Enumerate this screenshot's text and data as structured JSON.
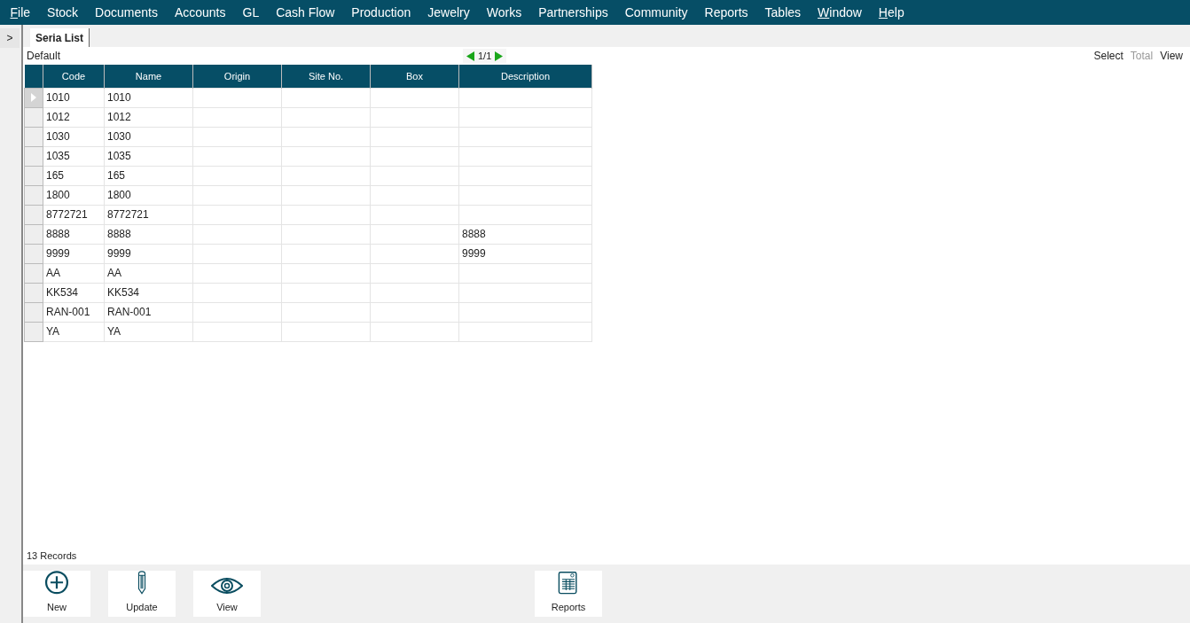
{
  "menu": [
    {
      "label": "File",
      "mnemonic": true
    },
    {
      "label": "Stock",
      "mnemonic": false
    },
    {
      "label": "Documents",
      "mnemonic": false
    },
    {
      "label": "Accounts",
      "mnemonic": false
    },
    {
      "label": "GL",
      "mnemonic": false
    },
    {
      "label": "Cash Flow",
      "mnemonic": false
    },
    {
      "label": "Production",
      "mnemonic": false
    },
    {
      "label": "Jewelry",
      "mnemonic": false
    },
    {
      "label": "Works",
      "mnemonic": false
    },
    {
      "label": "Partnerships",
      "mnemonic": false
    },
    {
      "label": "Community",
      "mnemonic": false
    },
    {
      "label": "Reports",
      "mnemonic": false
    },
    {
      "label": "Tables",
      "mnemonic": false
    },
    {
      "label": "Window",
      "mnemonic": true
    },
    {
      "label": "Help",
      "mnemonic": true
    }
  ],
  "side_toggle": ">",
  "tabs": [
    {
      "label": "Seria List",
      "selected": true
    }
  ],
  "view_name": "Default",
  "pager": {
    "text": "1/1"
  },
  "view_actions": [
    {
      "label": "Select",
      "disabled": false
    },
    {
      "label": "Total",
      "disabled": true
    },
    {
      "label": "View",
      "disabled": false
    }
  ],
  "table": {
    "columns": [
      "Code",
      "Name",
      "Origin",
      "Site No.",
      "Box",
      "Description"
    ],
    "rows": [
      {
        "selected": true,
        "cells": [
          "1010",
          "1010",
          "",
          "",
          "",
          ""
        ]
      },
      {
        "selected": false,
        "cells": [
          "1012",
          "1012",
          "",
          "",
          "",
          ""
        ]
      },
      {
        "selected": false,
        "cells": [
          "1030",
          "1030",
          "",
          "",
          "",
          ""
        ]
      },
      {
        "selected": false,
        "cells": [
          "1035",
          "1035",
          "",
          "",
          "",
          ""
        ]
      },
      {
        "selected": false,
        "cells": [
          "165",
          "165",
          "",
          "",
          "",
          ""
        ]
      },
      {
        "selected": false,
        "cells": [
          "1800",
          "1800",
          "",
          "",
          "",
          ""
        ]
      },
      {
        "selected": false,
        "cells": [
          "8772721",
          "8772721",
          "",
          "",
          "",
          ""
        ]
      },
      {
        "selected": false,
        "cells": [
          "8888",
          "8888",
          "",
          "",
          "",
          "8888"
        ]
      },
      {
        "selected": false,
        "cells": [
          "9999",
          "9999",
          "",
          "",
          "",
          "9999"
        ]
      },
      {
        "selected": false,
        "cells": [
          "AA",
          "AA",
          "",
          "",
          "",
          ""
        ]
      },
      {
        "selected": false,
        "cells": [
          "KK534",
          "KK534",
          "",
          "",
          "",
          ""
        ]
      },
      {
        "selected": false,
        "cells": [
          "RAN-001",
          "RAN-001",
          "",
          "",
          "",
          ""
        ]
      },
      {
        "selected": false,
        "cells": [
          "YA",
          "YA",
          "",
          "",
          "",
          ""
        ]
      }
    ]
  },
  "record_count": "13 Records",
  "buttons": [
    {
      "kind": "new",
      "label": "New"
    },
    {
      "kind": "update",
      "label": "Update"
    },
    {
      "kind": "view",
      "label": "View"
    },
    {
      "kind": "reports",
      "label": "Reports"
    }
  ]
}
